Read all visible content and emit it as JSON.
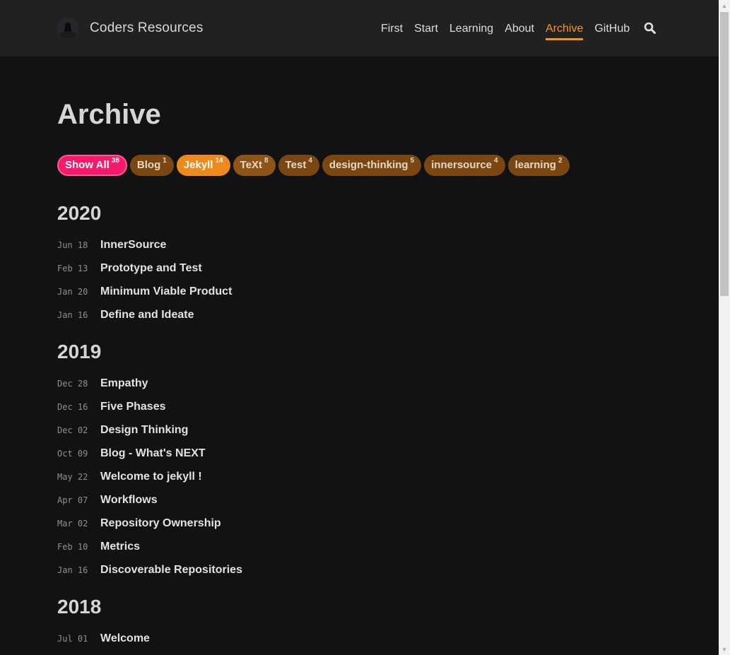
{
  "brand": {
    "title": "Coders Resources"
  },
  "nav": {
    "items": [
      {
        "label": "First"
      },
      {
        "label": "Start"
      },
      {
        "label": "Learning"
      },
      {
        "label": "About"
      },
      {
        "label": "Archive",
        "active": true
      },
      {
        "label": "GitHub"
      }
    ]
  },
  "page": {
    "title": "Archive"
  },
  "tags": [
    {
      "label": "Show All",
      "count": "38"
    },
    {
      "label": "Blog",
      "count": "1"
    },
    {
      "label": "Jekyll",
      "count": "14"
    },
    {
      "label": "TeXt",
      "count": "8"
    },
    {
      "label": "Test",
      "count": "4"
    },
    {
      "label": "design-thinking",
      "count": "5"
    },
    {
      "label": "innersource",
      "count": "4"
    },
    {
      "label": "learning",
      "count": "2"
    }
  ],
  "years": [
    {
      "year": "2020",
      "posts": [
        {
          "date": "Jun 18",
          "title": "InnerSource"
        },
        {
          "date": "Feb 13",
          "title": "Prototype and Test"
        },
        {
          "date": "Jan 20",
          "title": "Minimum Viable Product"
        },
        {
          "date": "Jan 16",
          "title": "Define and Ideate"
        }
      ]
    },
    {
      "year": "2019",
      "posts": [
        {
          "date": "Dec 28",
          "title": "Empathy"
        },
        {
          "date": "Dec 16",
          "title": "Five Phases"
        },
        {
          "date": "Dec 02",
          "title": "Design Thinking"
        },
        {
          "date": "Oct 09",
          "title": "Blog - What's NEXT"
        },
        {
          "date": "May 22",
          "title": "Welcome to jekyll !"
        },
        {
          "date": "Apr 07",
          "title": "Workflows"
        },
        {
          "date": "Mar 02",
          "title": "Repository Ownership"
        },
        {
          "date": "Feb 10",
          "title": "Metrics"
        },
        {
          "date": "Jan 16",
          "title": "Discoverable Repositories"
        }
      ]
    },
    {
      "year": "2018",
      "posts": [
        {
          "date": "Jul 01",
          "title": "Welcome"
        }
      ]
    }
  ],
  "colors": {
    "accent": "#f7931e",
    "show_all_tag": "#f51a6b",
    "tag": "#7a4712",
    "background": "#121214",
    "header": "#212122"
  },
  "icons": {
    "search": "search-icon",
    "logo": "logo-icon"
  }
}
